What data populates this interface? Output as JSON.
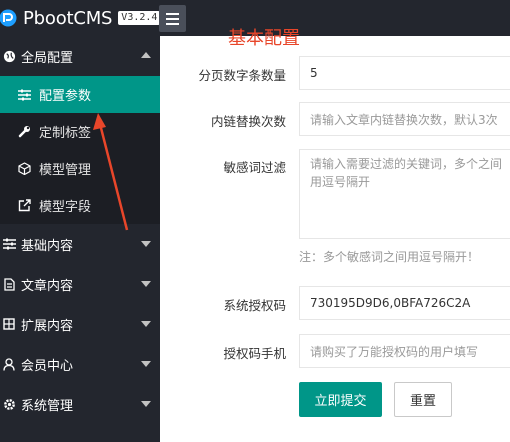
{
  "app": {
    "name": "PbootCMS",
    "version": "V3.2.4"
  },
  "sidebar": {
    "groups": [
      {
        "label": "全局配置",
        "icon": "globe-icon",
        "expanded": true,
        "children": [
          {
            "label": "配置参数",
            "icon": "sliders-icon",
            "active": true
          },
          {
            "label": "定制标签",
            "icon": "wrench-icon"
          },
          {
            "label": "模型管理",
            "icon": "cube-icon"
          },
          {
            "label": "模型字段",
            "icon": "external-link-icon"
          }
        ]
      },
      {
        "label": "基础内容",
        "icon": "sliders-icon"
      },
      {
        "label": "文章内容",
        "icon": "file-icon"
      },
      {
        "label": "扩展内容",
        "icon": "puzzle-icon"
      },
      {
        "label": "会员中心",
        "icon": "user-icon"
      },
      {
        "label": "系统管理",
        "icon": "gear-icon"
      }
    ]
  },
  "main": {
    "heading": "基本配置",
    "fields": {
      "page_size": {
        "label": "分页数字条数量",
        "value": "5"
      },
      "link_replace": {
        "label": "内链替换次数",
        "placeholder": "请输入文章内链替换次数，默认3次"
      },
      "sensitive": {
        "label": "敏感词过滤",
        "placeholder": "请输入需要过滤的关键词，多个之间用逗号隔开",
        "hint": "注：多个敏感词之间用逗号隔开！"
      },
      "auth_code": {
        "label": "系统授权码",
        "value": "730195D9D6,0BFA726C2A"
      },
      "auth_phone": {
        "label": "授权码手机",
        "placeholder": "请购买了万能授权码的用户填写"
      }
    },
    "buttons": {
      "submit": "立即提交",
      "reset": "重置"
    }
  },
  "colors": {
    "accent": "#009688",
    "sidebar_bg": "#23262e",
    "annotation": "#e8462a"
  }
}
